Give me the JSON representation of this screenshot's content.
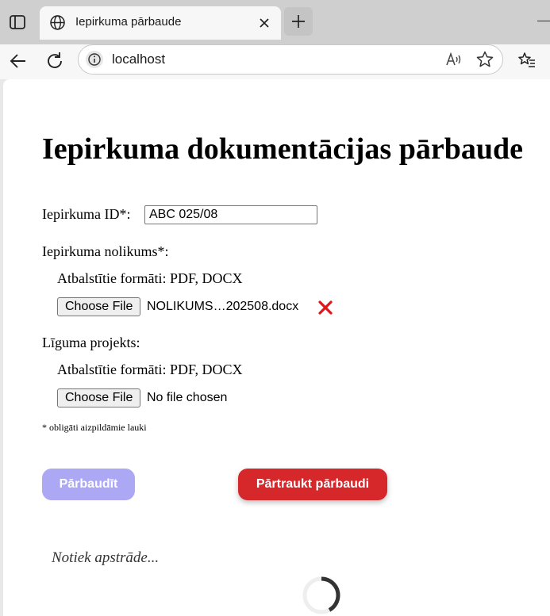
{
  "browser": {
    "tab_title": "Iepirkuma pārbaude",
    "url": "localhost"
  },
  "page": {
    "title": "Iepirkuma dokumentācijas pārbaude",
    "procurement_id": {
      "label": "Iepirkuma ID*:",
      "value": "ABC 025/08"
    },
    "regulations": {
      "label": "Iepirkuma nolikums*:",
      "formats": "Atbalstītie formāti: PDF, DOCX",
      "choose_label": "Choose File",
      "file_name": "NOLIKUMS…202508.docx"
    },
    "contract": {
      "label": "Līguma projekts:",
      "formats": "Atbalstītie formāti: PDF, DOCX",
      "choose_label": "Choose File",
      "file_name": "No file chosen"
    },
    "required_note": "* obligāti aizpildāmie lauki",
    "check_button": "Pārbaudīt",
    "stop_button": "Pārtraukt pārbaudi",
    "status_text": "Notiek apstrāde..."
  },
  "colors": {
    "check_button_disabled": "#aca8f4",
    "stop_button": "#d6272b",
    "remove_icon": "#e0161b"
  },
  "icons": [
    "sidebar-toggle-icon",
    "globe-icon",
    "close-icon",
    "plus-icon",
    "back-arrow-icon",
    "reload-icon",
    "info-icon",
    "read-aloud-icon",
    "star-icon",
    "favorites-icon",
    "remove-x-icon",
    "spinner-icon"
  ]
}
